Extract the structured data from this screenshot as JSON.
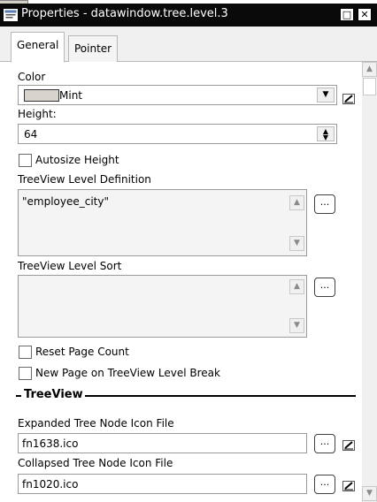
{
  "window": {
    "title": "Properties - datawindow.tree.level.3",
    "restore_glyph": "□",
    "close_glyph": "✕"
  },
  "tabs": [
    {
      "label": "General",
      "active": true
    },
    {
      "label": "Pointer",
      "active": false
    }
  ],
  "general": {
    "color_label": "Color",
    "color_value": "Mint",
    "height_label": "Height:",
    "height_value": "64",
    "autosize_label": "Autosize Height",
    "autosize_checked": false,
    "level_definition_label": "TreeView Level Definition",
    "level_definition_value": "\"employee_city\"",
    "level_sort_label": "TreeView Level Sort",
    "level_sort_value": "",
    "reset_page_count_label": "Reset Page Count",
    "reset_page_count_checked": false,
    "new_page_label": "New Page on TreeView Level Break",
    "new_page_checked": false,
    "section_title": "TreeView",
    "expanded_icon_label": "Expanded Tree Node Icon File",
    "expanded_icon_value": "fn1638.ico",
    "collapsed_icon_label": "Collapsed Tree Node Icon File",
    "collapsed_icon_value": "fn1020.ico",
    "ellipsis_label": "..."
  },
  "icons": {
    "window_icon": "properties-window-icon",
    "dropdown": "chevron-down-icon",
    "spinner": "spin-updown-icon",
    "scroll_up": "scroll-up-arrow-icon",
    "scroll_down": "scroll-down-arrow-icon",
    "expression": "expression-button-icon"
  }
}
